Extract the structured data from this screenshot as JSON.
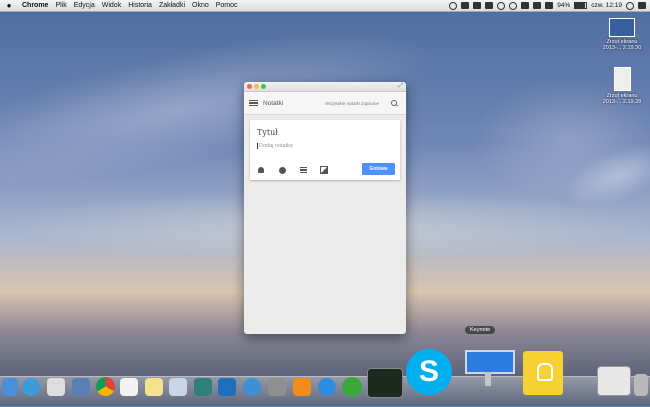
{
  "menubar": {
    "app_name": "Chrome",
    "menus": [
      "Plik",
      "Edycja",
      "Widok",
      "Historia",
      "Zakładki",
      "Okno",
      "Pomoc"
    ],
    "battery": "94%",
    "clock": "czw. 12:19"
  },
  "desktop": {
    "icons": [
      {
        "name": "Zrzut ekranu",
        "subtitle": "2013-... 2.19.30"
      },
      {
        "name": "Zrzut ekranu",
        "subtitle": "2013-... 2.19.38"
      }
    ]
  },
  "app": {
    "title": "Notatki",
    "saved_label": "Wszystkie notatki zapisane",
    "note_title_placeholder": "Tytuł",
    "note_body_placeholder": "Dodaj notatkę",
    "done_label": "Gotowe"
  },
  "dock": {
    "tooltip": "Keynote"
  }
}
